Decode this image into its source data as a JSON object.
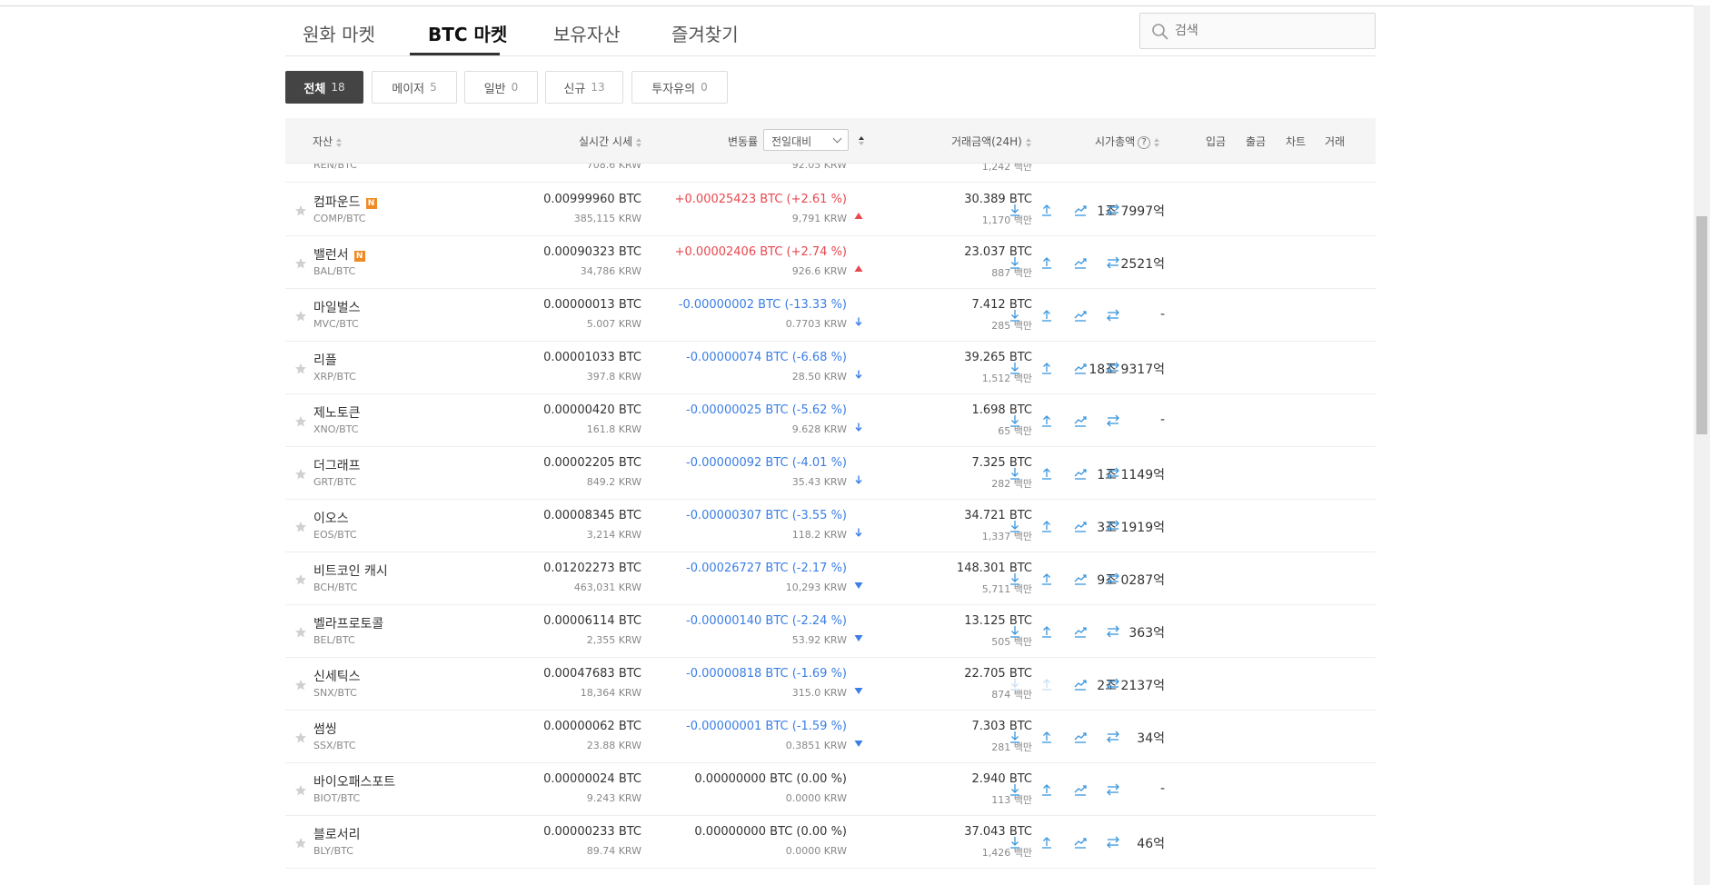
{
  "tabs": [
    {
      "label": "원화 마켓"
    },
    {
      "label": "BTC 마켓"
    },
    {
      "label": "보유자산"
    },
    {
      "label": "즐겨찾기"
    }
  ],
  "active_tab": "BTC 마켓",
  "search": {
    "placeholder": "검색"
  },
  "filters": [
    {
      "label": "전체",
      "count": "18"
    },
    {
      "label": "메이저",
      "count": "5"
    },
    {
      "label": "일반",
      "count": "0"
    },
    {
      "label": "신규",
      "count": "13"
    },
    {
      "label": "투자유의",
      "count": "0"
    }
  ],
  "columns": {
    "asset": "자산",
    "price": "실시간 시세",
    "change": "변동률",
    "compare": "전일대비",
    "volume": "거래금액(24H)",
    "mcap": "시가총액",
    "deposit": "입금",
    "withdraw": "출금",
    "chart": "차트",
    "trade": "거래"
  },
  "partial_top_row": {
    "code": "REN/BTC",
    "price_krw": "708.6 KRW",
    "change_krw": "92.05 KRW",
    "vol_sub": "1,242 백만",
    "mcap": "-"
  },
  "rows": [
    {
      "name": "컴파운드",
      "new": true,
      "code": "COMP/BTC",
      "price": "0.00999960 BTC",
      "price_krw": "385,115 KRW",
      "change": "+0.00025423 BTC (+2.61 %)",
      "change_krw": "9,791 KRW",
      "dir": "up",
      "vol": "30.389 BTC",
      "vol_sub": "1,170 백만",
      "mcap": "1조 7997억"
    },
    {
      "name": "밸런서",
      "new": true,
      "code": "BAL/BTC",
      "price": "0.00090323 BTC",
      "price_krw": "34,786 KRW",
      "change": "+0.00002406 BTC (+2.74 %)",
      "change_krw": "926.6 KRW",
      "dir": "up",
      "vol": "23.037 BTC",
      "vol_sub": "887 백만",
      "mcap": "2521억"
    },
    {
      "name": "마일벌스",
      "new": false,
      "code": "MVC/BTC",
      "price": "0.00000013 BTC",
      "price_krw": "5.007 KRW",
      "change": "-0.00000002 BTC (-13.33 %)",
      "change_krw": "0.7703 KRW",
      "dir": "down-arrow",
      "vol": "7.412 BTC",
      "vol_sub": "285 백만",
      "mcap": "-"
    },
    {
      "name": "리플",
      "new": false,
      "code": "XRP/BTC",
      "price": "0.00001033 BTC",
      "price_krw": "397.8 KRW",
      "change": "-0.00000074 BTC (-6.68 %)",
      "change_krw": "28.50 KRW",
      "dir": "down-arrow",
      "vol": "39.265 BTC",
      "vol_sub": "1,512 백만",
      "mcap": "18조 9317억"
    },
    {
      "name": "제노토큰",
      "new": false,
      "code": "XNO/BTC",
      "price": "0.00000420 BTC",
      "price_krw": "161.8 KRW",
      "change": "-0.00000025 BTC (-5.62 %)",
      "change_krw": "9.628 KRW",
      "dir": "down-arrow",
      "vol": "1.698 BTC",
      "vol_sub": "65 백만",
      "mcap": "-"
    },
    {
      "name": "더그래프",
      "new": false,
      "code": "GRT/BTC",
      "price": "0.00002205 BTC",
      "price_krw": "849.2 KRW",
      "change": "-0.00000092 BTC (-4.01 %)",
      "change_krw": "35.43 KRW",
      "dir": "down-arrow",
      "vol": "7.325 BTC",
      "vol_sub": "282 백만",
      "mcap": "1조 1149억"
    },
    {
      "name": "이오스",
      "new": false,
      "code": "EOS/BTC",
      "price": "0.00008345 BTC",
      "price_krw": "3,214 KRW",
      "change": "-0.00000307 BTC (-3.55 %)",
      "change_krw": "118.2 KRW",
      "dir": "down-arrow",
      "vol": "34.721 BTC",
      "vol_sub": "1,337 백만",
      "mcap": "3조 1919억"
    },
    {
      "name": "비트코인 캐시",
      "new": false,
      "code": "BCH/BTC",
      "price": "0.01202273 BTC",
      "price_krw": "463,031 KRW",
      "change": "-0.00026727 BTC (-2.17 %)",
      "change_krw": "10,293 KRW",
      "dir": "down",
      "vol": "148.301 BTC",
      "vol_sub": "5,711 백만",
      "mcap": "9조 0287억"
    },
    {
      "name": "벨라프로토콜",
      "new": false,
      "code": "BEL/BTC",
      "price": "0.00006114 BTC",
      "price_krw": "2,355 KRW",
      "change": "-0.00000140 BTC (-2.24 %)",
      "change_krw": "53.92 KRW",
      "dir": "down",
      "vol": "13.125 BTC",
      "vol_sub": "505 백만",
      "mcap": "363억"
    },
    {
      "name": "신세틱스",
      "new": false,
      "code": "SNX/BTC",
      "price": "0.00047683 BTC",
      "price_krw": "18,364 KRW",
      "change": "-0.00000818 BTC (-1.69 %)",
      "change_krw": "315.0 KRW",
      "dir": "down",
      "vol": "22.705 BTC",
      "vol_sub": "874 백만",
      "mcap": "2조 2137억",
      "disabled": true
    },
    {
      "name": "썸씽",
      "new": false,
      "code": "SSX/BTC",
      "price": "0.00000062 BTC",
      "price_krw": "23.88 KRW",
      "change": "-0.00000001 BTC (-1.59 %)",
      "change_krw": "0.3851 KRW",
      "dir": "down",
      "vol": "7.303 BTC",
      "vol_sub": "281 백만",
      "mcap": "34억"
    },
    {
      "name": "바이오패스포트",
      "new": false,
      "code": "BIOT/BTC",
      "price": "0.00000024 BTC",
      "price_krw": "9.243 KRW",
      "change": "0.00000000 BTC (0.00 %)",
      "change_krw": "0.0000 KRW",
      "dir": "flat",
      "vol": "2.940 BTC",
      "vol_sub": "113 백만",
      "mcap": "-"
    },
    {
      "name": "블로서리",
      "new": false,
      "code": "BLY/BTC",
      "price": "0.00000233 BTC",
      "price_krw": "89.74 KRW",
      "change": "0.00000000 BTC (0.00 %)",
      "change_krw": "0.0000 KRW",
      "dir": "flat",
      "vol": "37.043 BTC",
      "vol_sub": "1,426 백만",
      "mcap": "46억"
    }
  ],
  "colors": {
    "up": "#e8484f",
    "down": "#3a7ee6",
    "action": "#3a96dd",
    "badge": "#f08a24"
  }
}
